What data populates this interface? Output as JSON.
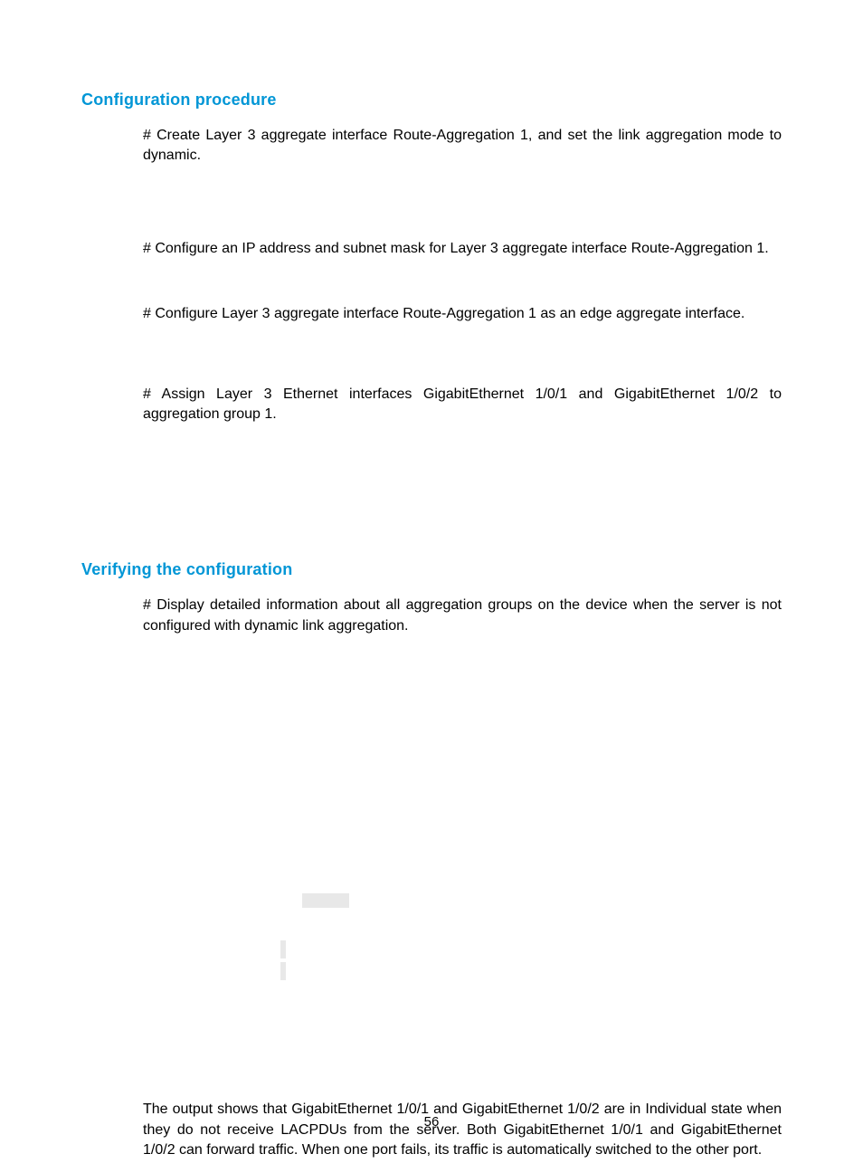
{
  "section1": {
    "heading": "Configuration procedure",
    "p1": "# Create Layer 3 aggregate interface Route-Aggregation 1, and set the link aggregation mode to dynamic.",
    "p2": "# Configure an IP address and subnet mask for Layer 3 aggregate interface Route-Aggregation 1.",
    "p3": "# Configure Layer 3 aggregate interface Route-Aggregation 1 as an edge aggregate interface.",
    "p4": "# Assign Layer 3 Ethernet interfaces GigabitEthernet 1/0/1 and GigabitEthernet 1/0/2 to aggregation group 1."
  },
  "section2": {
    "heading": "Verifying the configuration",
    "p1": "# Display detailed information about all aggregation groups on the device when the server is not configured with dynamic link aggregation.",
    "p2": "The output shows that GigabitEthernet 1/0/1 and GigabitEthernet 1/0/2 are in Individual state when they do not receive LACPDUs from the server. Both GigabitEthernet 1/0/1 and GigabitEthernet 1/0/2 can forward traffic. When one port fails, its traffic is automatically switched to the other port."
  },
  "page_number": "56"
}
